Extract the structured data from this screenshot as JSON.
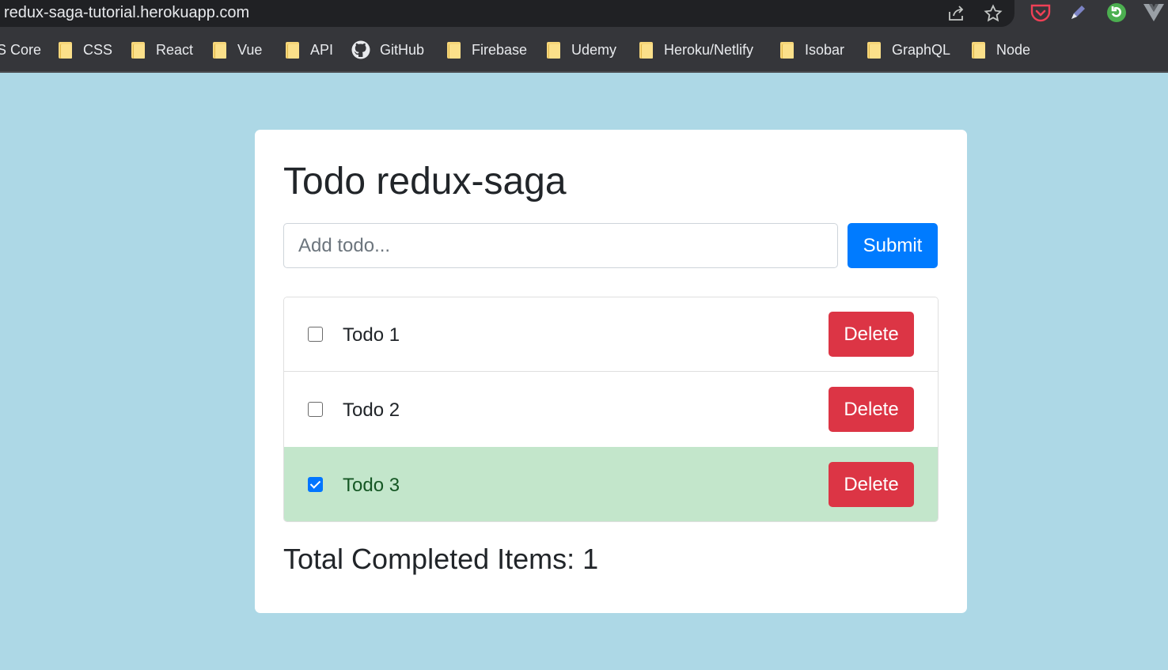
{
  "browser": {
    "url": "redux-saga-tutorial.herokuapp.com",
    "bookmarks": [
      {
        "label": "S Core",
        "icon": "none"
      },
      {
        "label": "CSS",
        "icon": "folder-icon"
      },
      {
        "label": "React",
        "icon": "folder-icon"
      },
      {
        "label": "Vue",
        "icon": "folder-icon"
      },
      {
        "label": "API",
        "icon": "folder-icon"
      },
      {
        "label": "GitHub",
        "icon": "github-icon"
      },
      {
        "label": "Firebase",
        "icon": "folder-icon"
      },
      {
        "label": "Udemy",
        "icon": "folder-icon"
      },
      {
        "label": "Heroku/Netlify",
        "icon": "folder-icon"
      },
      {
        "label": "Isobar",
        "icon": "folder-icon"
      },
      {
        "label": "GraphQL",
        "icon": "folder-icon"
      },
      {
        "label": "Node",
        "icon": "folder-icon"
      }
    ],
    "toolbar_icons": [
      "share-icon",
      "star-icon",
      "pocket-icon",
      "pen-icon",
      "refresh-extension-icon",
      "vue-devtools-icon"
    ]
  },
  "app": {
    "title": "Todo redux-saga",
    "input": {
      "placeholder": "Add todo...",
      "value": ""
    },
    "submit_label": "Submit",
    "todos": [
      {
        "text": "Todo 1",
        "completed": false,
        "delete_label": "Delete"
      },
      {
        "text": "Todo 2",
        "completed": false,
        "delete_label": "Delete"
      },
      {
        "text": "Todo 3",
        "completed": true,
        "delete_label": "Delete"
      }
    ],
    "total_completed": "Total Completed Items: 1"
  },
  "colors": {
    "page_background": "#add8e6",
    "primary": "#007bff",
    "danger": "#dc3545",
    "completed_row": "#c3e6cb",
    "completed_text": "#155724"
  }
}
